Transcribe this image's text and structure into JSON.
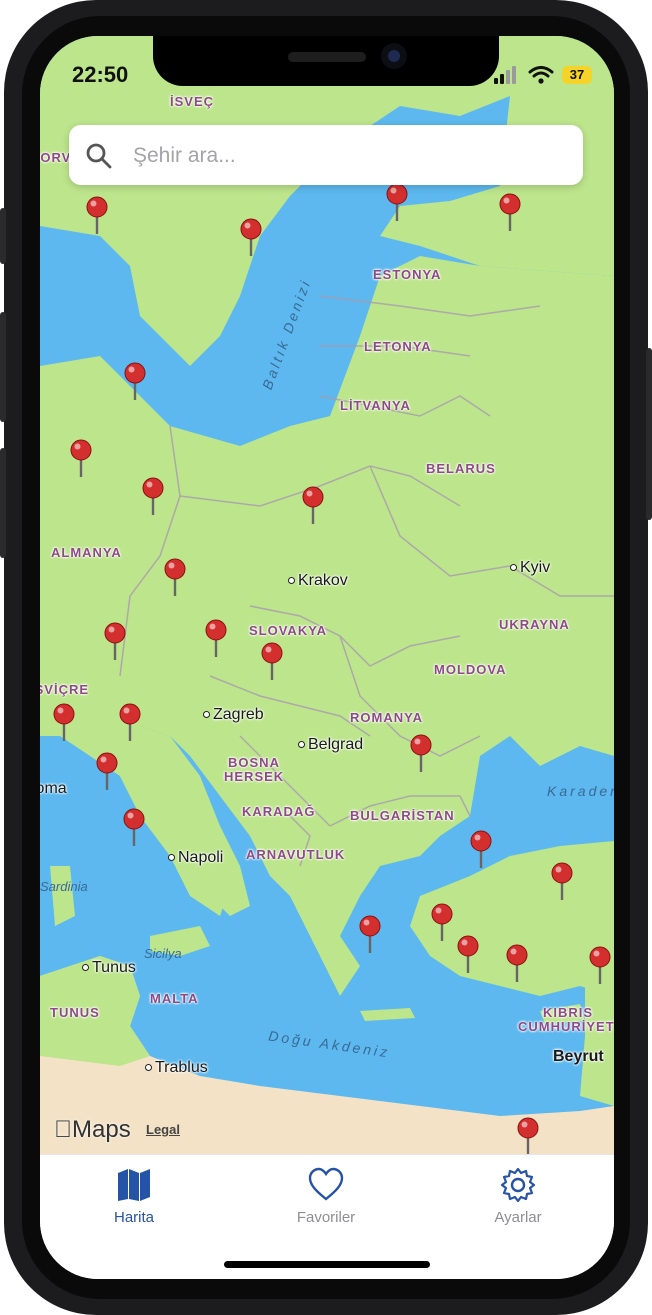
{
  "status_bar": {
    "time": "22:50",
    "battery": "37",
    "signal_icon": "cellular-signal-icon",
    "wifi_icon": "wifi-icon"
  },
  "search": {
    "placeholder": "Şehir ara...",
    "icon": "search-icon"
  },
  "map": {
    "countries": [
      "İSVEÇ",
      "ESTONYA",
      "LETONYA",
      "LİTVANYA",
      "BELARUS",
      "ALMANYA",
      "SLOVAKYA",
      "UKRAYNA",
      "MOLDOVA",
      "ROMANYA",
      "BOSNA HERSEK",
      "KARADAĞ",
      "BULGARİSTAN",
      "ARNAVUTLUK",
      "MALTA",
      "TUNUS",
      "KIBRIS CUMHURİYETİ",
      "NORVEÇ",
      "İSVİÇRE"
    ],
    "cities": [
      "Krakov",
      "Kyiv",
      "Zagreb",
      "Belgrad",
      "Napoli",
      "Tunus",
      "Trablus",
      "Beyrut"
    ],
    "water": [
      "Baltık Denizi",
      "Doğu Akdeniz",
      "Karadeniz"
    ],
    "regions": [
      "Sardinia",
      "Sicilya",
      "Roma"
    ],
    "pin_count": 26,
    "pin_color": "#d32f2f",
    "attribution": "Maps",
    "legal": "Legal"
  },
  "tabs": [
    {
      "label": "Harita",
      "icon": "map-icon",
      "active": true
    },
    {
      "label": "Favoriler",
      "icon": "heart-icon",
      "active": false
    },
    {
      "label": "Ayarlar",
      "icon": "gear-icon",
      "active": false
    }
  ],
  "colors": {
    "accent": "#2553a6",
    "land": "#bde58c",
    "sea": "#5cb8ee",
    "inactive_tab": "#8e8e93"
  }
}
